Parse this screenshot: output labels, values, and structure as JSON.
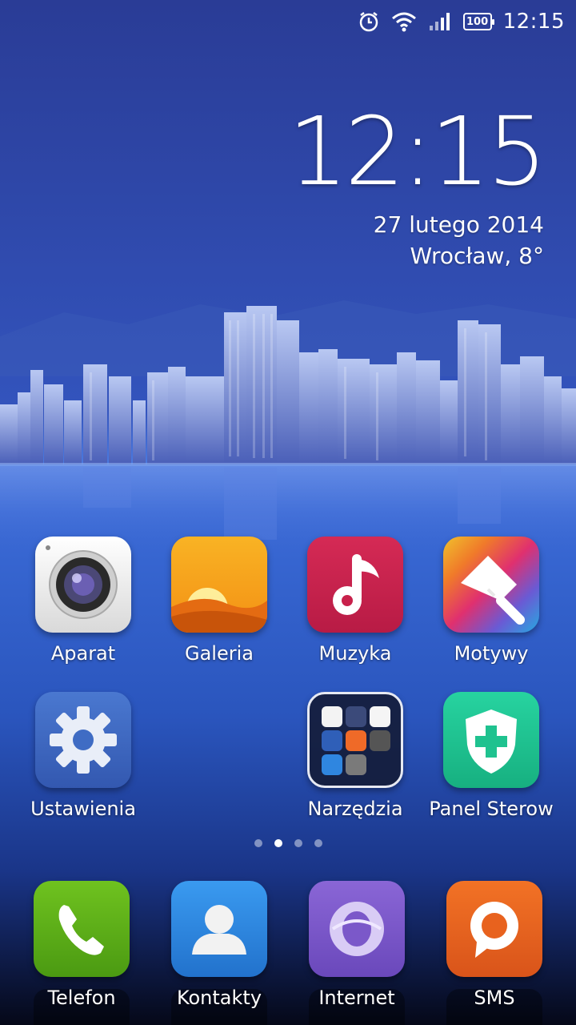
{
  "status_bar": {
    "battery": "100",
    "time": "12:15",
    "icons": [
      "alarm-icon",
      "wifi-icon",
      "signal-icon",
      "battery-icon"
    ]
  },
  "clock_widget": {
    "time": "12:15",
    "date": "27 lutego 2014",
    "weather": "Wrocław, 8°"
  },
  "home_apps": [
    {
      "label": "Aparat",
      "icon": "camera-icon"
    },
    {
      "label": "Galeria",
      "icon": "gallery-icon"
    },
    {
      "label": "Muzyka",
      "icon": "music-icon"
    },
    {
      "label": "Motywy",
      "icon": "themes-brush-icon"
    },
    {
      "label": "Ustawienia",
      "icon": "settings-gear-icon"
    },
    {
      "label": "Narzędzia",
      "icon": "tools-folder-icon"
    },
    {
      "label": "Panel Sterow",
      "icon": "security-shield-icon"
    }
  ],
  "page_indicator": {
    "count": 4,
    "active": 2
  },
  "dock": [
    {
      "label": "Telefon",
      "icon": "phone-icon"
    },
    {
      "label": "Kontakty",
      "icon": "contacts-icon"
    },
    {
      "label": "Internet",
      "icon": "browser-icon"
    },
    {
      "label": "SMS",
      "icon": "sms-icon"
    }
  ],
  "colors": {
    "camera": "#f2f2f2",
    "gallery": "#f7a21b",
    "music": "#c8214b",
    "settings": "#3f6cc4",
    "security": "#1fc28f",
    "phone": "#55a81a",
    "contacts": "#2f86e0",
    "browser": "#7b58c9",
    "sms": "#e8621e"
  }
}
